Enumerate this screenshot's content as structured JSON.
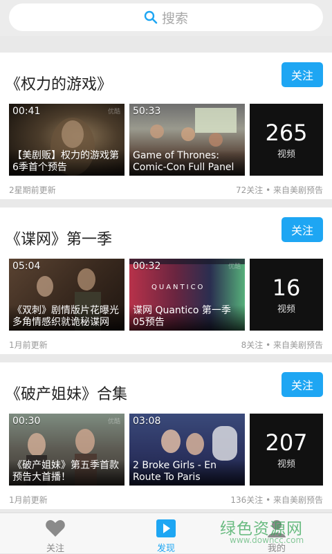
{
  "search": {
    "placeholder": "搜索"
  },
  "cards": [
    {
      "title": "《权力的游戏》",
      "follow_label": "关注",
      "videos": [
        {
          "duration": "00:41",
          "caption": "【美剧贩】权力的游戏第6季首个预告",
          "watermark": "优酷"
        },
        {
          "duration": "50:33",
          "caption": "Game of Thrones: Comic-Con Full Panel",
          "watermark": ""
        }
      ],
      "more_count": "265",
      "more_label": "视频",
      "updated": "2星期前更新",
      "stats": "72关注 • 来自美剧预告"
    },
    {
      "title": "《谍网》第一季",
      "follow_label": "关注",
      "videos": [
        {
          "duration": "05:04",
          "caption": "《双刺》剧情版片花曝光多角情感织就诡秘谍网",
          "watermark": ""
        },
        {
          "duration": "00:32",
          "caption": "谍网 Quantico 第一季05预告",
          "watermark": "优酷"
        }
      ],
      "more_count": "16",
      "more_label": "视频",
      "updated": "1月前更新",
      "stats": "8关注 • 来自美剧预告"
    },
    {
      "title": "《破产姐妹》合集",
      "follow_label": "关注",
      "videos": [
        {
          "duration": "00:30",
          "caption": "《破产姐妹》第五季首款预告大首播！",
          "watermark": "优酷"
        },
        {
          "duration": "03:08",
          "caption": "2 Broke Girls - En Route To Paris",
          "watermark": ""
        }
      ],
      "more_count": "207",
      "more_label": "视频",
      "updated": "1月前更新",
      "stats": "136关注 • 来自美剧预告"
    }
  ],
  "bottom_nav": [
    {
      "label": "关注",
      "icon": "heart-icon",
      "active": false
    },
    {
      "label": "发现",
      "icon": "play-icon",
      "active": true
    },
    {
      "label": "我的",
      "icon": "person-icon",
      "active": false
    }
  ],
  "site_watermark": {
    "text": "绿色资源网",
    "url": "www.downcc.com"
  },
  "colors": {
    "accent": "#1ea6f3",
    "inactive": "#8a8a8a",
    "background": "#e9e9e9"
  }
}
